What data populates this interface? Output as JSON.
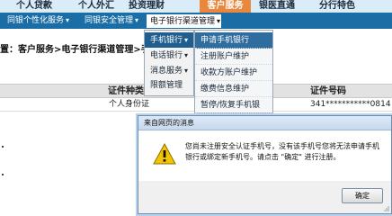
{
  "top_nav": {
    "items": [
      {
        "label": "个人贷款"
      },
      {
        "label": "个人外汇"
      },
      {
        "label": "投资理财"
      },
      {
        "label": "客户服务"
      },
      {
        "label": "银医直通"
      },
      {
        "label": "分行特色"
      }
    ]
  },
  "sub_nav": {
    "items": [
      {
        "label": "同银个性化服务"
      },
      {
        "label": "同银安全管理"
      },
      {
        "label": "电子银行渠道管理"
      }
    ]
  },
  "breadcrumb": "置：客户服务>电子银行渠道管理>手机",
  "menu_level1": {
    "items": [
      {
        "label": "手机银行"
      },
      {
        "label": "电话银行"
      },
      {
        "label": "消息服务"
      },
      {
        "label": "限额管理"
      }
    ]
  },
  "menu_level2": {
    "items": [
      {
        "label": "申请手机银行"
      },
      {
        "label": "注册账户维护"
      },
      {
        "label": "收款方账户维护"
      },
      {
        "label": "缴费信息维护"
      },
      {
        "label": "暂停/恢复手机银"
      }
    ]
  },
  "table": {
    "headers": {
      "id_type": "证件种类",
      "id_number": "证件号码"
    },
    "row": {
      "id_type": "个人身份证",
      "id_number": "341***********0814"
    }
  },
  "dialog": {
    "title": "来自网页的消息",
    "message": "您尚未注册安全认证手机号，没有该手机号您将无法申请手机银行或绑定新手机号。请点击 \"确定\" 进行注册。",
    "ok_label": "确定",
    "icon": "warning-icon"
  },
  "colors": {
    "accent": "#e9873c",
    "subnav": "#1b6ea5",
    "menu_selected": "#1f5e8e"
  }
}
